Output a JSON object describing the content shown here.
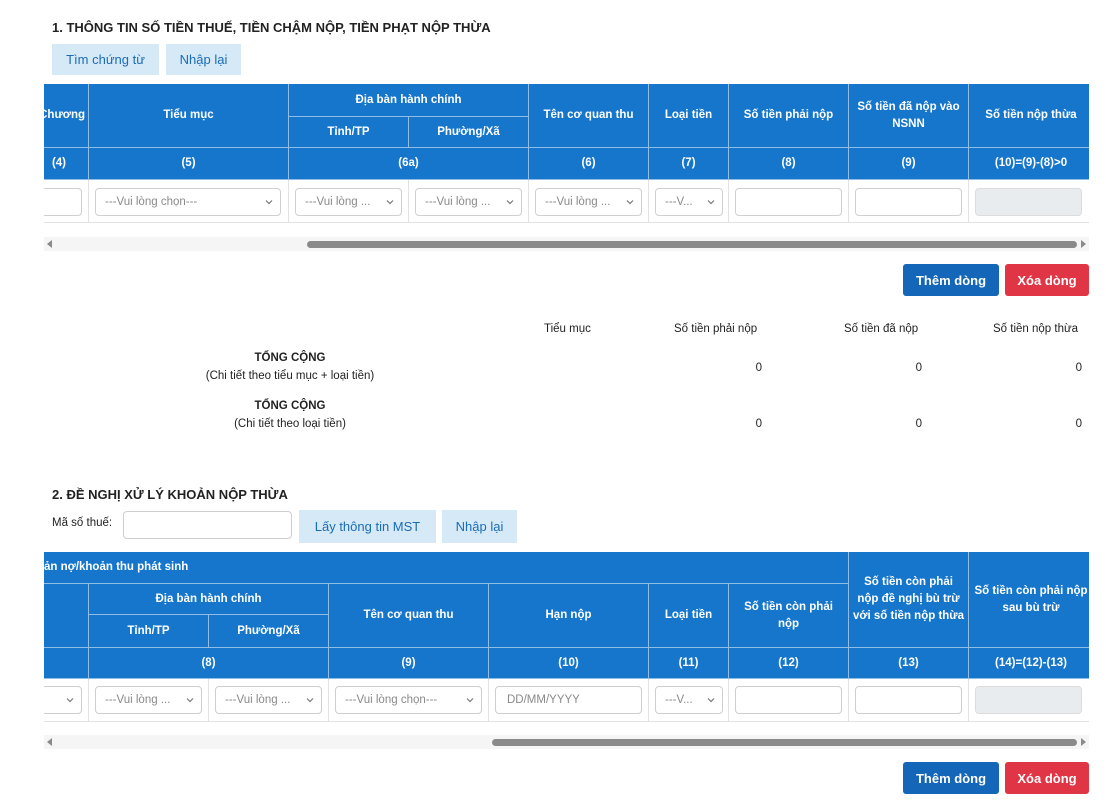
{
  "section1": {
    "title": "1. THÔNG TIN SỐ TIỀN THUẾ, TIỀN CHẬM NỘP, TIỀN PHẠT NỘP THỪA",
    "btn_find": "Tìm chứng từ",
    "btn_reset": "Nhập lại",
    "headers": {
      "chuong": "Chương",
      "tieu_muc": "Tiểu mục",
      "dia_ban": "Địa bàn hành chính",
      "tinh": "Tỉnh/TP",
      "phuong": "Phường/Xã",
      "co_quan": "Tên cơ quan thu",
      "loai_tien": "Loại tiền",
      "phai_nop": "Số tiền phải nộp",
      "da_nop": "Số tiền đã nộp vào NSNN",
      "nop_thua": "Số tiền nộp thừa"
    },
    "nums": [
      "(4)",
      "(5)",
      "(6a)",
      "(6)",
      "(7)",
      "(8)",
      "(9)",
      "(10)=(9)-(8)>0"
    ],
    "row": {
      "tieu_muc": "---Vui lòng chọn---",
      "tinh": "---Vui lòng ...",
      "phuong": "---Vui lòng ...",
      "co_quan": "---Vui lòng ...",
      "loai_tien": "---V..."
    },
    "btn_add": "Thêm dòng",
    "btn_delete": "Xóa dòng"
  },
  "summary": {
    "col_tieu_muc": "Tiểu mục",
    "col_phai_nop": "Số tiền phải nộp",
    "col_da_nop": "Số tiền đã nộp",
    "col_nop_thua": "Số tiền nộp thừa",
    "rows": [
      {
        "title": "TỔNG CỘNG",
        "sub": "(Chi tiết theo tiểu mục + loại tiền)",
        "phai_nop": "0",
        "da_nop": "0",
        "nop_thua": "0"
      },
      {
        "title": "TỔNG CỘNG",
        "sub": "(Chi tiết theo loại tiền)",
        "phai_nop": "0",
        "da_nop": "0",
        "nop_thua": "0"
      }
    ]
  },
  "section2": {
    "title": "2. ĐỀ NGHỊ XỬ LÝ KHOẢN NỘP THỪA",
    "mst_label": "Mã số thuế:",
    "mst_value": "",
    "btn_get": "Lấy thông tin MST",
    "btn_reset": "Nhập lại",
    "headers": {
      "group": "ản nợ/khoản thu phát sinh",
      "dia_ban": "Địa bàn hành chính",
      "tinh": "Tỉnh/TP",
      "phuong": "Phường/Xã",
      "co_quan": "Tên cơ quan thu",
      "han_nop": "Hạn nộp",
      "loai_tien": "Loại tiền",
      "con_phai_nop": "Số tiền còn phải nộp",
      "bu_tru": "Số tiền còn phải nộp đề nghị bù trừ với số tiền nộp thừa",
      "sau_bu_tru": "Số tiền còn phải nộp sau bù trừ"
    },
    "nums": [
      "(8)",
      "(9)",
      "(10)",
      "(11)",
      "(12)",
      "(13)",
      "(14)=(12)-(13)"
    ],
    "row": {
      "tinh": "---Vui lòng ...",
      "phuong": "---Vui lòng ...",
      "co_quan": "---Vui lòng chọn---",
      "han_nop_placeholder": "DD/MM/YYYY",
      "loai_tien": "---V..."
    },
    "btn_add": "Thêm dòng",
    "btn_delete": "Xóa dòng"
  },
  "scroll1": {
    "position": 0.33
  },
  "scroll2": {
    "position": 0.49
  }
}
